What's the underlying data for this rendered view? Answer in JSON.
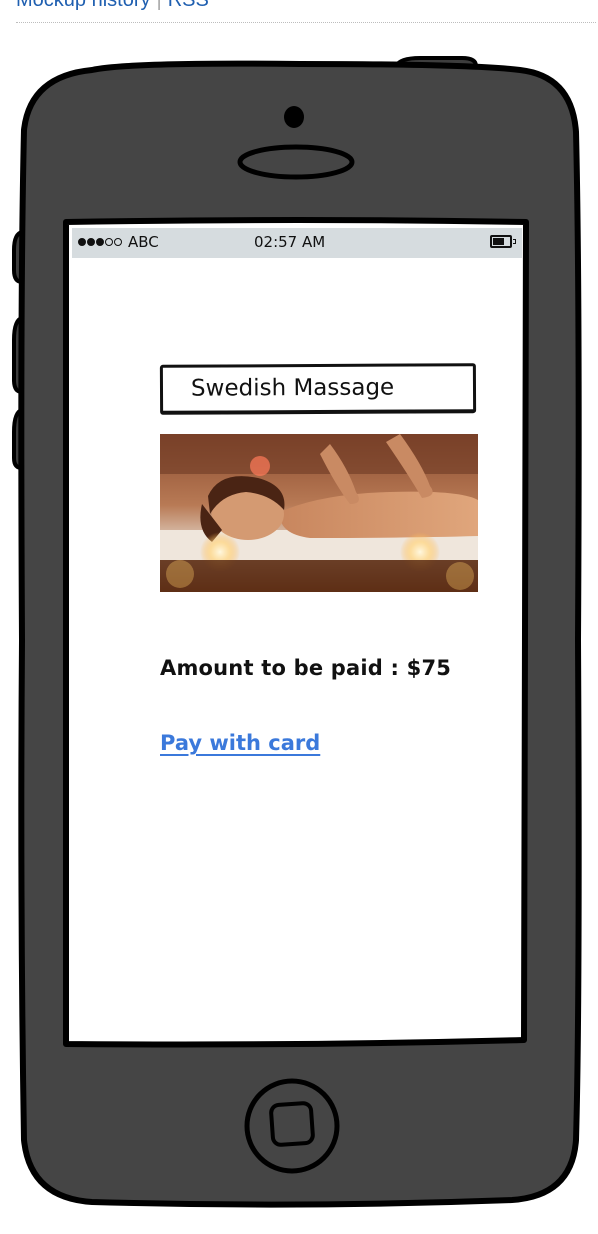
{
  "top_links": {
    "history_label": "Mockup history",
    "separator": "|",
    "rss_label": "RSS"
  },
  "status_bar": {
    "signal_filled": 3,
    "signal_total": 5,
    "carrier": "ABC",
    "time": "02:57 AM",
    "battery_icon": "battery-icon"
  },
  "screen": {
    "title": "Swedish Massage",
    "image_subject": "massage-photo",
    "amount_text": "Amount to be paid : $75",
    "pay_link": "Pay with card"
  },
  "colors": {
    "link": "#3b79db",
    "phone_body": "#444444",
    "status_bar_bg": "#d6dcdf"
  }
}
